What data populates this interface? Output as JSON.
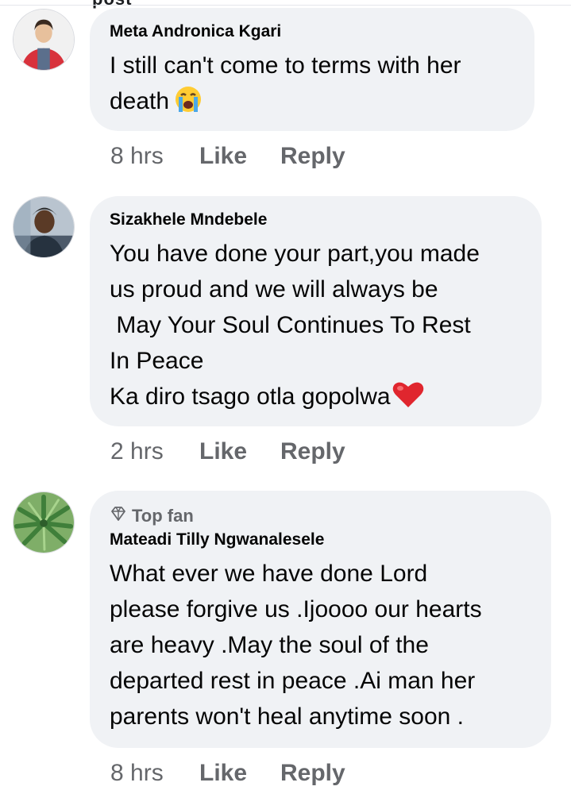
{
  "top_cut_text": "post",
  "comments": [
    {
      "author": "Meta Andronica Kgari",
      "lines": [
        "I still can't come to terms with her",
        "death"
      ],
      "emoji": "crying-face",
      "time": "8 hrs",
      "like_label": "Like",
      "reply_label": "Reply"
    },
    {
      "author": "Sizakhele Mndebele",
      "lines": [
        "You have done your part,you made",
        "us proud and we will always be",
        " May Your Soul Continues To Rest",
        "In Peace",
        "Ka diro tsago otla gopolwa"
      ],
      "emoji": "red-heart",
      "time": "2 hrs",
      "like_label": "Like",
      "reply_label": "Reply"
    },
    {
      "badge": "Top fan",
      "badge_icon": "diamond-icon",
      "author": "Mateadi Tilly Ngwanalesele",
      "lines": [
        "What ever we have done Lord",
        "please forgive us .Ijoooo our hearts",
        "are heavy .May the soul of the",
        "departed rest in peace .Ai man her",
        "parents won't heal anytime soon ."
      ],
      "time": "8 hrs",
      "like_label": "Like",
      "reply_label": "Reply"
    }
  ],
  "colors": {
    "bubble_bg": "#f0f2f5",
    "text": "#050505",
    "meta": "#65676b"
  }
}
